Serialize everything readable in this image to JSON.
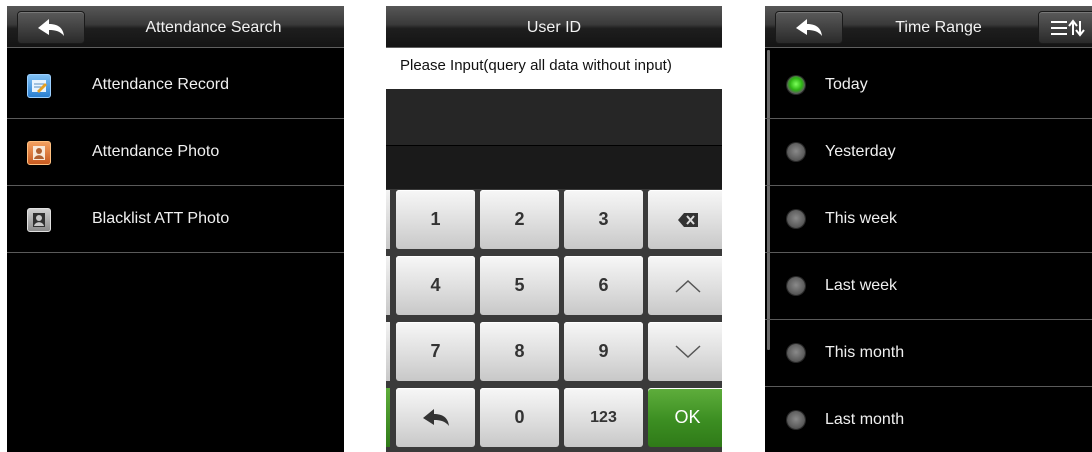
{
  "screen1": {
    "title": "Attendance Search",
    "items": [
      {
        "label": "Attendance Record",
        "icon": "attendance-record-icon"
      },
      {
        "label": "Attendance Photo",
        "icon": "attendance-photo-icon"
      },
      {
        "label": "Blacklist ATT Photo",
        "icon": "blacklist-photo-icon"
      }
    ]
  },
  "screen2": {
    "title": "User ID",
    "input_placeholder": "Please Input(query all data without input)",
    "keys": {
      "k1": "1",
      "k2": "2",
      "k3": "3",
      "k4": "4",
      "k5": "5",
      "k6": "6",
      "k7": "7",
      "k8": "8",
      "k9": "9",
      "k0": "0",
      "k123": "123",
      "ok": "OK"
    }
  },
  "screen3": {
    "title": "Time Range",
    "options": [
      {
        "label": "Today",
        "selected": true
      },
      {
        "label": "Yesterday",
        "selected": false
      },
      {
        "label": "This week",
        "selected": false
      },
      {
        "label": "Last week",
        "selected": false
      },
      {
        "label": "This month",
        "selected": false
      },
      {
        "label": "Last month",
        "selected": false
      }
    ]
  },
  "colors": {
    "selected_radio": "#2cb312",
    "ok_key": "#3c8e22",
    "background": "#000000"
  }
}
